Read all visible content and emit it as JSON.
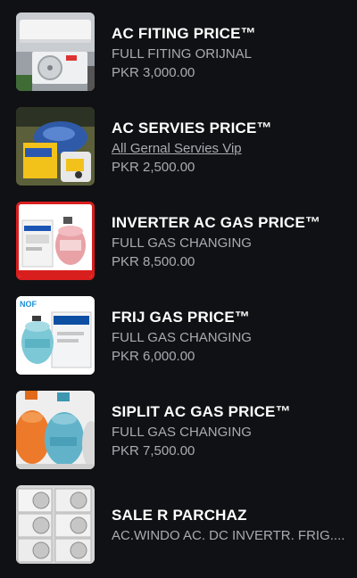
{
  "items": [
    {
      "title": "AC FITING PRICE™",
      "subtitle": "FULL FITING ORIJNAL",
      "price": "PKR 3,000.00",
      "thumb_icon": "split-ac-unit-image"
    },
    {
      "title": "AC SERVIES PRICE™",
      "subtitle": "All Gernal Servies Vip",
      "price": "PKR 2,500.00",
      "thumb_icon": "vacuum-pump-image"
    },
    {
      "title": "INVERTER AC GAS PRICE™",
      "subtitle": "FULL GAS CHANGING",
      "price": "PKR 8,500.00",
      "thumb_icon": "gas-cylinder-box-image"
    },
    {
      "title": "FRIJ GAS PRICE™",
      "subtitle": "FULL GAS CHANGING",
      "price": "PKR 6,000.00",
      "thumb_icon": "refrigerant-cylinder-image",
      "brand": "NOF"
    },
    {
      "title": "SIPLIT AC GAS PRICE™",
      "subtitle": "FULL GAS CHANGING",
      "price": "PKR 7,500.00",
      "thumb_icon": "multiple-gas-cylinders-image"
    },
    {
      "title": "SALE R PARCHAZ",
      "subtitle": "AC.WINDO AC. DC INVERTR. FRIG....",
      "price": "",
      "thumb_icon": "outdoor-ac-units-image"
    }
  ],
  "colors": {
    "background": "#101114",
    "title": "#ffffff",
    "secondary": "#a9abb0"
  }
}
